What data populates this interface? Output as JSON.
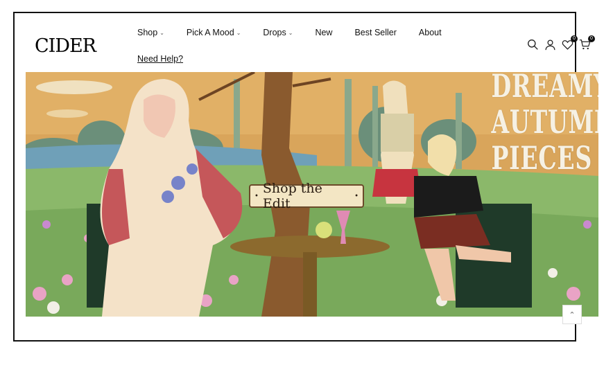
{
  "brand": {
    "logo_text": "CIDER"
  },
  "nav": {
    "items": [
      {
        "label": "Shop",
        "chevron": "chevron-down-icon"
      },
      {
        "label": "Pick A Mood",
        "chevron": "chevron-down-icon"
      },
      {
        "label": "Drops",
        "chevron": "chevron-down-icon"
      },
      {
        "label": "New"
      },
      {
        "label": "Best Seller"
      },
      {
        "label": "About"
      }
    ],
    "need_help": "Need Help?"
  },
  "header_icons": {
    "search": "search-icon",
    "account": "user-icon",
    "wishlist": "heart-icon",
    "wishlist_count": "0",
    "cart": "cart-icon",
    "cart_count": "0"
  },
  "hero": {
    "title_lines": [
      "DREAMY",
      "AUTUMN",
      "PIECES"
    ],
    "cta_label": "Shop the Edit"
  },
  "scroll_top": {
    "icon": "chevron-up-icon",
    "glyph": "⌃"
  },
  "colors": {
    "hero_bg": "#d8a65a",
    "title": "#f6f1e4",
    "cta_bg": "#f3e6c4"
  }
}
